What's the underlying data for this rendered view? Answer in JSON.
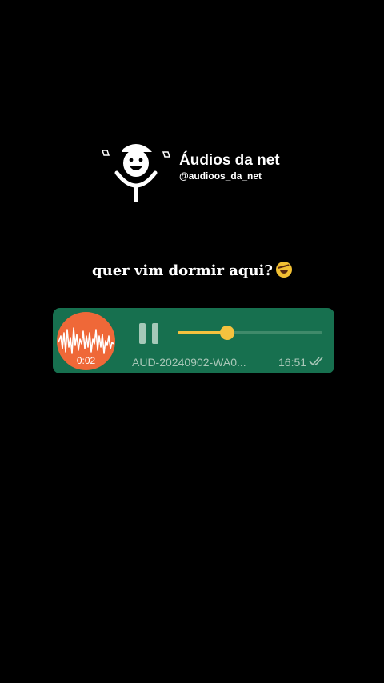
{
  "brand": {
    "title": "Áudios da net",
    "handle": "@audioos_da_net",
    "logo_icon": "microphone-mascot-icon"
  },
  "caption": {
    "text": "quer vim dormir aqui?",
    "emoji": "rolling-on-floor-laughing-emoji"
  },
  "voice_message": {
    "duration": "0:02",
    "file_name": "AUD-20240902-WA0...",
    "time": "16:51",
    "status_icon": "double-check-icon",
    "control_icon": "pause-icon",
    "progress": 0.34,
    "colors": {
      "bubble": "#17704f",
      "avatar": "#ef6838",
      "progress": "#f5c23e"
    }
  }
}
